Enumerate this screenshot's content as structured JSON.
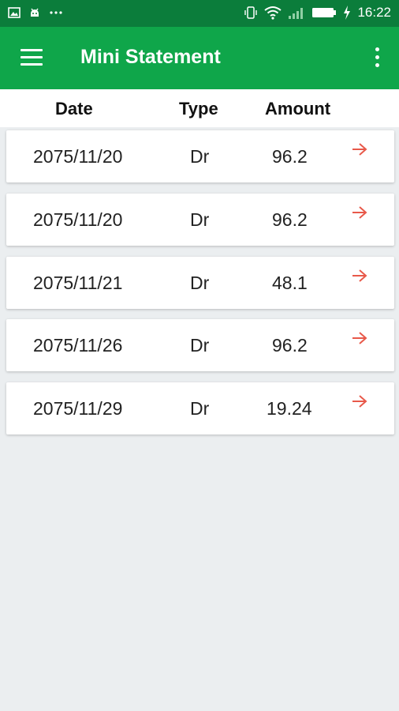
{
  "status_bar": {
    "time": "16:22",
    "icons": [
      "image-icon",
      "android-icon",
      "more-dots-icon",
      "vibrate-icon",
      "wifi-icon",
      "signal-icon",
      "battery-icon",
      "charging-icon"
    ]
  },
  "app_bar": {
    "title": "Mini Statement",
    "menu_icon": "hamburger-menu-icon",
    "overflow_icon": "more-vert-icon",
    "color": "#0fa64a"
  },
  "table": {
    "headers": {
      "date": "Date",
      "type": "Type",
      "amount": "Amount"
    },
    "rows": [
      {
        "date": "2075/11/20",
        "type": "Dr",
        "amount": "96.2"
      },
      {
        "date": "2075/11/20",
        "type": "Dr",
        "amount": "96.2"
      },
      {
        "date": "2075/11/21",
        "type": "Dr",
        "amount": "48.1"
      },
      {
        "date": "2075/11/26",
        "type": "Dr",
        "amount": "96.2"
      },
      {
        "date": "2075/11/29",
        "type": "Dr",
        "amount": "19.24"
      }
    ],
    "row_icon": "arrow-right-icon",
    "arrow_color": "#e8594a"
  }
}
